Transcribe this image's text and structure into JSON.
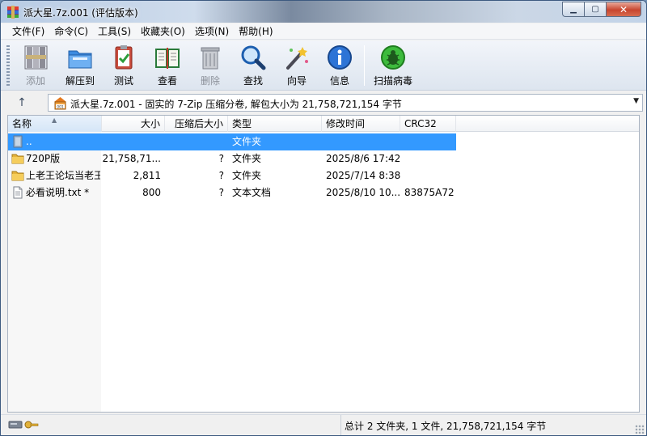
{
  "window": {
    "title": "派大星.7z.001 (评估版本)"
  },
  "menu": [
    "文件(F)",
    "命令(C)",
    "工具(S)",
    "收藏夹(O)",
    "选项(N)",
    "帮助(H)"
  ],
  "toolbar": {
    "add": "添加",
    "extract": "解压到",
    "test": "测试",
    "view": "查看",
    "delete": "删除",
    "find": "查找",
    "wizard": "向导",
    "info": "信息",
    "scan": "扫描病毒"
  },
  "address": {
    "text": "派大星.7z.001 - 固实的 7-Zip 压缩分卷, 解包大小为 21,758,721,154 字节"
  },
  "columns": {
    "name": "名称",
    "size": "大小",
    "packed": "压缩后大小",
    "type": "类型",
    "modified": "修改时间",
    "crc": "CRC32"
  },
  "rows": [
    {
      "name": "..",
      "size": "",
      "packed": "",
      "type": "文件夹",
      "modified": "",
      "crc": "",
      "icon": "up-folder-icon"
    },
    {
      "name": "720P版",
      "size": "21,758,71...",
      "packed": "?",
      "type": "文件夹",
      "modified": "2025/8/6 17:42",
      "crc": "",
      "icon": "folder-icon"
    },
    {
      "name": "上老王论坛当老王",
      "size": "2,811",
      "packed": "?",
      "type": "文件夹",
      "modified": "2025/7/14 8:38",
      "crc": "",
      "icon": "folder-icon"
    },
    {
      "name": "必看说明.txt *",
      "size": "800",
      "packed": "?",
      "type": "文本文档",
      "modified": "2025/8/10 10...",
      "crc": "83875A72",
      "icon": "text-file-icon"
    }
  ],
  "status": {
    "summary": "总计 2 文件夹, 1 文件, 21,758,721,154 字节"
  },
  "colors": {
    "selection": "#3399ff",
    "toolbar": "#dde5ef"
  }
}
